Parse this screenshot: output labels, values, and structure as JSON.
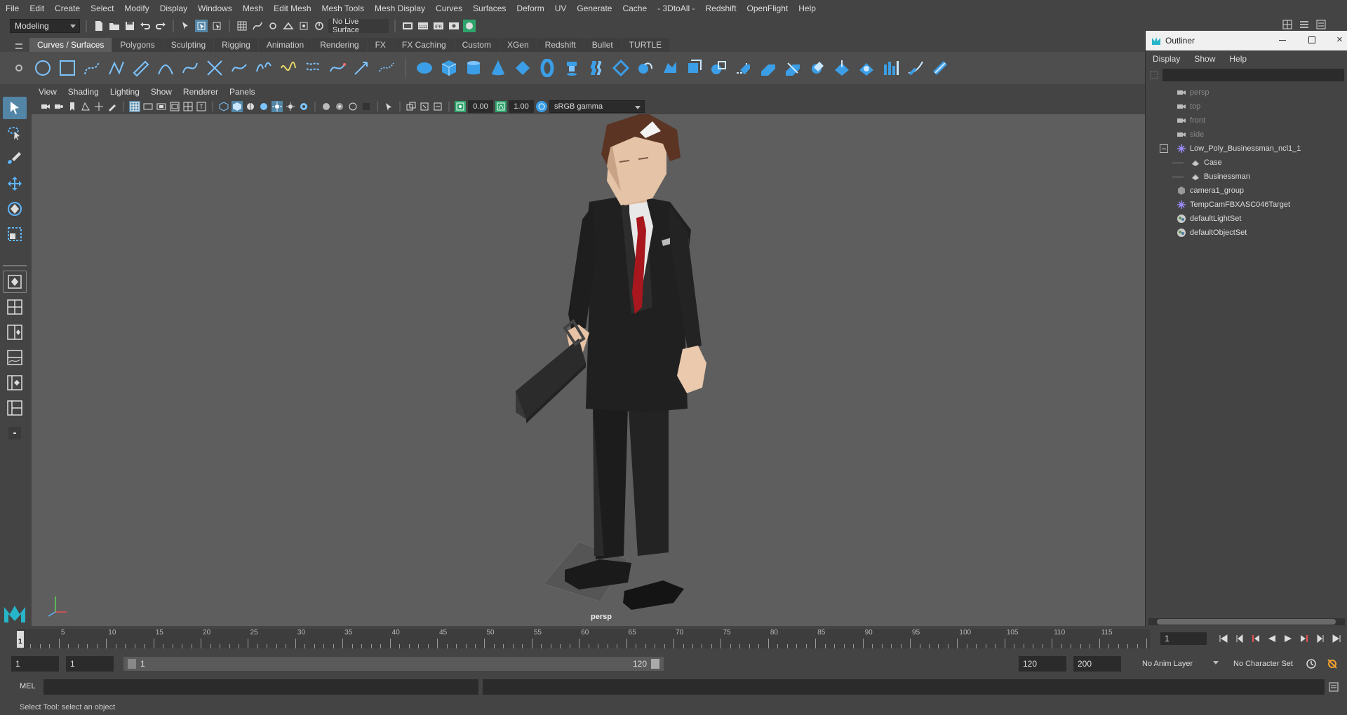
{
  "menubar": [
    "File",
    "Edit",
    "Create",
    "Select",
    "Modify",
    "Display",
    "Windows",
    "Mesh",
    "Edit Mesh",
    "Mesh Tools",
    "Mesh Display",
    "Curves",
    "Surfaces",
    "Deform",
    "UV",
    "Generate",
    "Cache",
    "- 3DtoAll -",
    "Redshift",
    "OpenFlight",
    "Help"
  ],
  "status": {
    "mode": "Modeling",
    "live_surface": "No Live Surface"
  },
  "shelf_tabs": [
    "Curves / Surfaces",
    "Polygons",
    "Sculpting",
    "Rigging",
    "Animation",
    "Rendering",
    "FX",
    "FX Caching",
    "Custom",
    "XGen",
    "Redshift",
    "Bullet",
    "TURTLE"
  ],
  "shelf_active": "Curves / Surfaces",
  "viewport": {
    "menus": [
      "View",
      "Shading",
      "Lighting",
      "Show",
      "Renderer",
      "Panels"
    ],
    "exposure": "0.00",
    "gamma": "1.00",
    "color_space": "sRGB gamma",
    "camera": "persp"
  },
  "outliner": {
    "title": "Outliner",
    "menus": [
      "Display",
      "Show",
      "Help"
    ],
    "items": [
      {
        "label": "persp",
        "icon": "camera-icon",
        "indent": 0,
        "dim": true
      },
      {
        "label": "top",
        "icon": "camera-icon",
        "indent": 0,
        "dim": true
      },
      {
        "label": "front",
        "icon": "camera-icon",
        "indent": 0,
        "dim": true
      },
      {
        "label": "side",
        "icon": "camera-icon",
        "indent": 0,
        "dim": true
      },
      {
        "label": "Low_Poly_Businessman_ncl1_1",
        "icon": "transform-icon",
        "indent": 0,
        "dim": false,
        "expander": "minus"
      },
      {
        "label": "Case",
        "icon": "mesh-icon",
        "indent": 1,
        "dim": false
      },
      {
        "label": "Businessman",
        "icon": "mesh-icon",
        "indent": 1,
        "dim": false
      },
      {
        "label": "camera1_group",
        "icon": "group-icon",
        "indent": 0,
        "dim": false
      },
      {
        "label": "TempCamFBXASC046Target",
        "icon": "transform-icon",
        "indent": 0,
        "dim": false
      },
      {
        "label": "defaultLightSet",
        "icon": "set-icon",
        "indent": 0,
        "dim": false
      },
      {
        "label": "defaultObjectSet",
        "icon": "set-icon",
        "indent": 0,
        "dim": false
      }
    ]
  },
  "timeslider": {
    "ticks": [
      "5",
      "10",
      "15",
      "20",
      "25",
      "30",
      "35",
      "40",
      "45",
      "50",
      "55",
      "60",
      "65",
      "70",
      "75",
      "80",
      "85",
      "90",
      "95",
      "100",
      "105",
      "110",
      "115"
    ],
    "current_marker": "1",
    "current_frame": "1"
  },
  "range": {
    "start": "1",
    "playback_start": "1",
    "slider_start": "1",
    "slider_end": "120",
    "playback_end": "120",
    "end": "200",
    "anim_layer": "No Anim Layer",
    "char_set": "No Character Set"
  },
  "cmdline": {
    "label": "MEL"
  },
  "helpline": "Select Tool: select an object"
}
